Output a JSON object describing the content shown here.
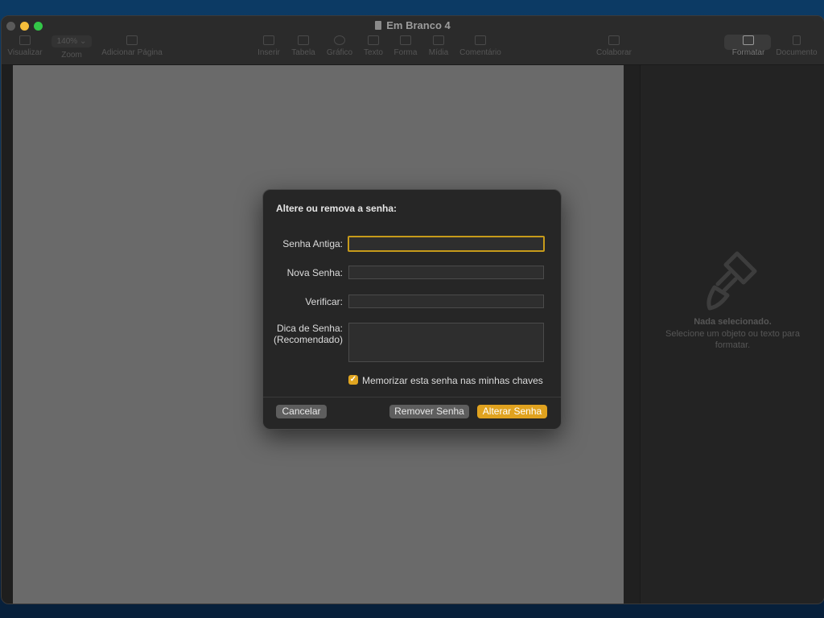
{
  "window": {
    "title": "Em Branco 4"
  },
  "toolbar": {
    "visualizar": "Visualizar",
    "zoom_value": "140%",
    "zoom_label": "Zoom",
    "adicionar_pagina": "Adicionar Página",
    "inserir": "Inserir",
    "tabela": "Tabela",
    "grafico": "Gráfico",
    "texto": "Texto",
    "forma": "Forma",
    "midia": "Mídia",
    "comentario": "Comentário",
    "colaborar": "Colaborar",
    "formatar": "Formatar",
    "documento": "Documento"
  },
  "inspector": {
    "icon": "paintbrush-icon",
    "title": "Nada selecionado.",
    "subtitle": "Selecione um objeto ou texto para formatar."
  },
  "dialog": {
    "title": "Altere ou remova a senha:",
    "old_password_label": "Senha Antiga:",
    "old_password_value": "",
    "new_password_label": "Nova Senha:",
    "new_password_value": "",
    "verify_label": "Verificar:",
    "verify_value": "",
    "hint_label_line1": "Dica de Senha:",
    "hint_label_line2": "(Recomendado)",
    "hint_value": "",
    "remember_checked": true,
    "remember_label": "Memorizar esta senha nas minhas chaves",
    "cancel_button": "Cancelar",
    "remove_button": "Remover Senha",
    "change_button": "Alterar Senha"
  },
  "colors": {
    "accent": "#e0a21f",
    "focus_ring": "#c79b1a",
    "canvas": "#6a6a6a"
  }
}
